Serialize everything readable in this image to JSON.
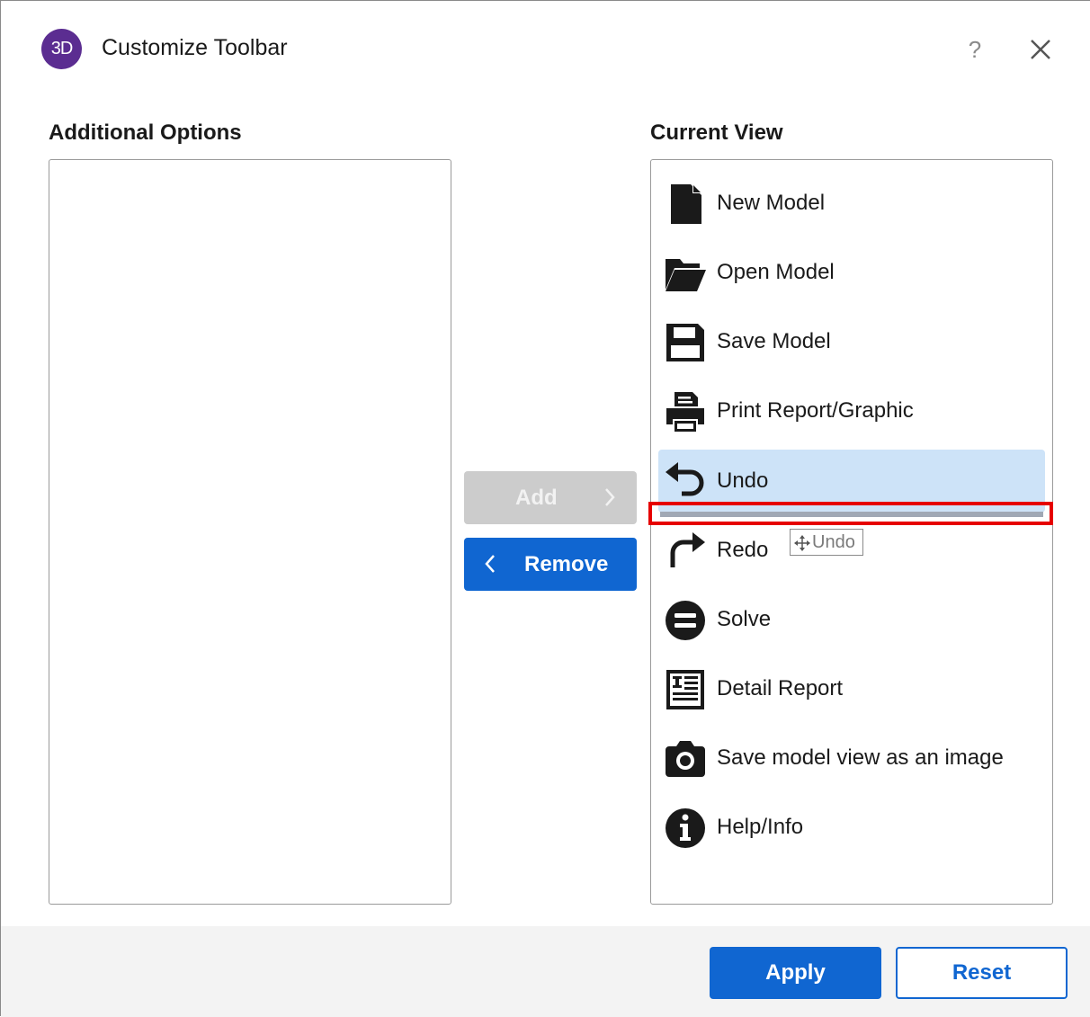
{
  "dialog": {
    "logo_text": "3D",
    "title": "Customize Toolbar",
    "help_label": "?"
  },
  "left_panel": {
    "heading": "Additional Options",
    "items": []
  },
  "right_panel": {
    "heading": "Current View",
    "items": [
      {
        "label": "New Model",
        "icon": "new-file-icon"
      },
      {
        "label": "Open Model",
        "icon": "folder-open-icon"
      },
      {
        "label": "Save Model",
        "icon": "floppy-disk-icon"
      },
      {
        "label": "Print Report/Graphic",
        "icon": "printer-icon"
      },
      {
        "label": "Undo",
        "icon": "undo-icon",
        "selected": true
      },
      {
        "label": "Redo",
        "icon": "redo-icon"
      },
      {
        "label": "Solve",
        "icon": "solve-icon"
      },
      {
        "label": "Detail Report",
        "icon": "report-icon"
      },
      {
        "label": "Save model view as an image",
        "icon": "camera-icon"
      },
      {
        "label": "Help/Info",
        "icon": "info-icon"
      }
    ],
    "drag_tooltip": "Undo"
  },
  "transfer": {
    "add_label": "Add",
    "remove_label": "Remove"
  },
  "footer": {
    "apply_label": "Apply",
    "reset_label": "Reset"
  },
  "colors": {
    "accent": "#1066d1",
    "selection": "#cde3f8",
    "highlight": "#e60000",
    "logo": "#5b2d91"
  }
}
